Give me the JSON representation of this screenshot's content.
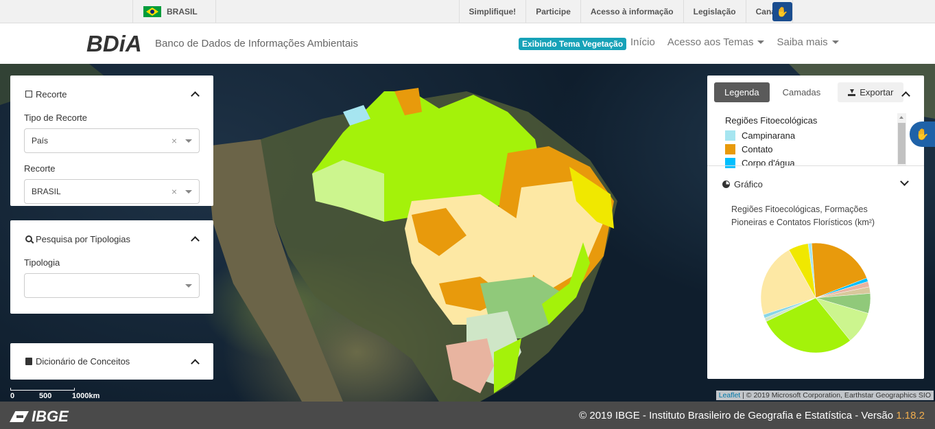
{
  "govbar": {
    "country": "BRASIL",
    "links": [
      "Simplifique!",
      "Participe",
      "Acesso à informação",
      "Legislação",
      "Canais"
    ],
    "vlibras_icon": "hand-sign-icon"
  },
  "header": {
    "logo": "BDiA",
    "subtitle": "Banco de Dados de Informações Ambientais",
    "theme_badge": "Exibindo Tema Vegetação",
    "nav": {
      "home": "Início",
      "themes": "Acesso aos Temas",
      "more": "Saiba mais"
    }
  },
  "left": {
    "recorte": {
      "title": "Recorte",
      "tipo_label": "Tipo de Recorte",
      "tipo_value": "País",
      "recorte_label": "Recorte",
      "recorte_value": "BRASIL"
    },
    "pesquisa": {
      "title": "Pesquisa por Tipologias",
      "tipologia_label": "Tipologia",
      "tipologia_value": ""
    },
    "dicionario": {
      "title": "Dicionário de Conceitos"
    }
  },
  "scale": {
    "labels": [
      "0",
      "500",
      "1000km"
    ]
  },
  "right": {
    "tabs": [
      "Legenda",
      "Camadas"
    ],
    "export_label": "Exportar",
    "legend_title": "Regiões Fitoecológicas",
    "legend_items": [
      {
        "label": "Campinarana",
        "color": "#a6e5f0"
      },
      {
        "label": "Contato",
        "color": "#e89a0c"
      },
      {
        "label": "Corpo d'água",
        "color": "#00bfff"
      }
    ],
    "grafico_title": "Gráfico",
    "chart_title": "Regiões Fitoecológicas, Formações Pioneiras e Contatos Florísticos (km²)"
  },
  "chart_data": {
    "type": "pie",
    "title": "Regiões Fitoecológicas, Formações Pioneiras e Contatos Florísticos (km²)",
    "slices": [
      {
        "value": 1.0,
        "color": "#a6e5f0"
      },
      {
        "value": 19.0,
        "color": "#e89a0c"
      },
      {
        "value": 1.0,
        "color": "#00bfff"
      },
      {
        "value": 1.5,
        "color": "#e8b4a0"
      },
      {
        "value": 1.8,
        "color": "#d8c89c"
      },
      {
        "value": 5.5,
        "color": "#90c97a"
      },
      {
        "value": 9.0,
        "color": "#ccf58e"
      },
      {
        "value": 27.0,
        "color": "#a4f20a"
      },
      {
        "value": 1.0,
        "color": "#cfe6c7"
      },
      {
        "value": 1.0,
        "color": "#88d6e8"
      },
      {
        "value": 20.5,
        "color": "#fde8a4"
      },
      {
        "value": 5.5,
        "color": "#f0e800"
      }
    ]
  },
  "attribution": {
    "leaflet": "Leaflet",
    "rest": "| © 2019 Microsoft Corporation, Earthstar Geographics SIO"
  },
  "footer": {
    "logo": "IBGE",
    "copyright": "© 2019 IBGE - Instituto Brasileiro de Geografia e Estatística - Versão",
    "version": "1.18.2"
  }
}
